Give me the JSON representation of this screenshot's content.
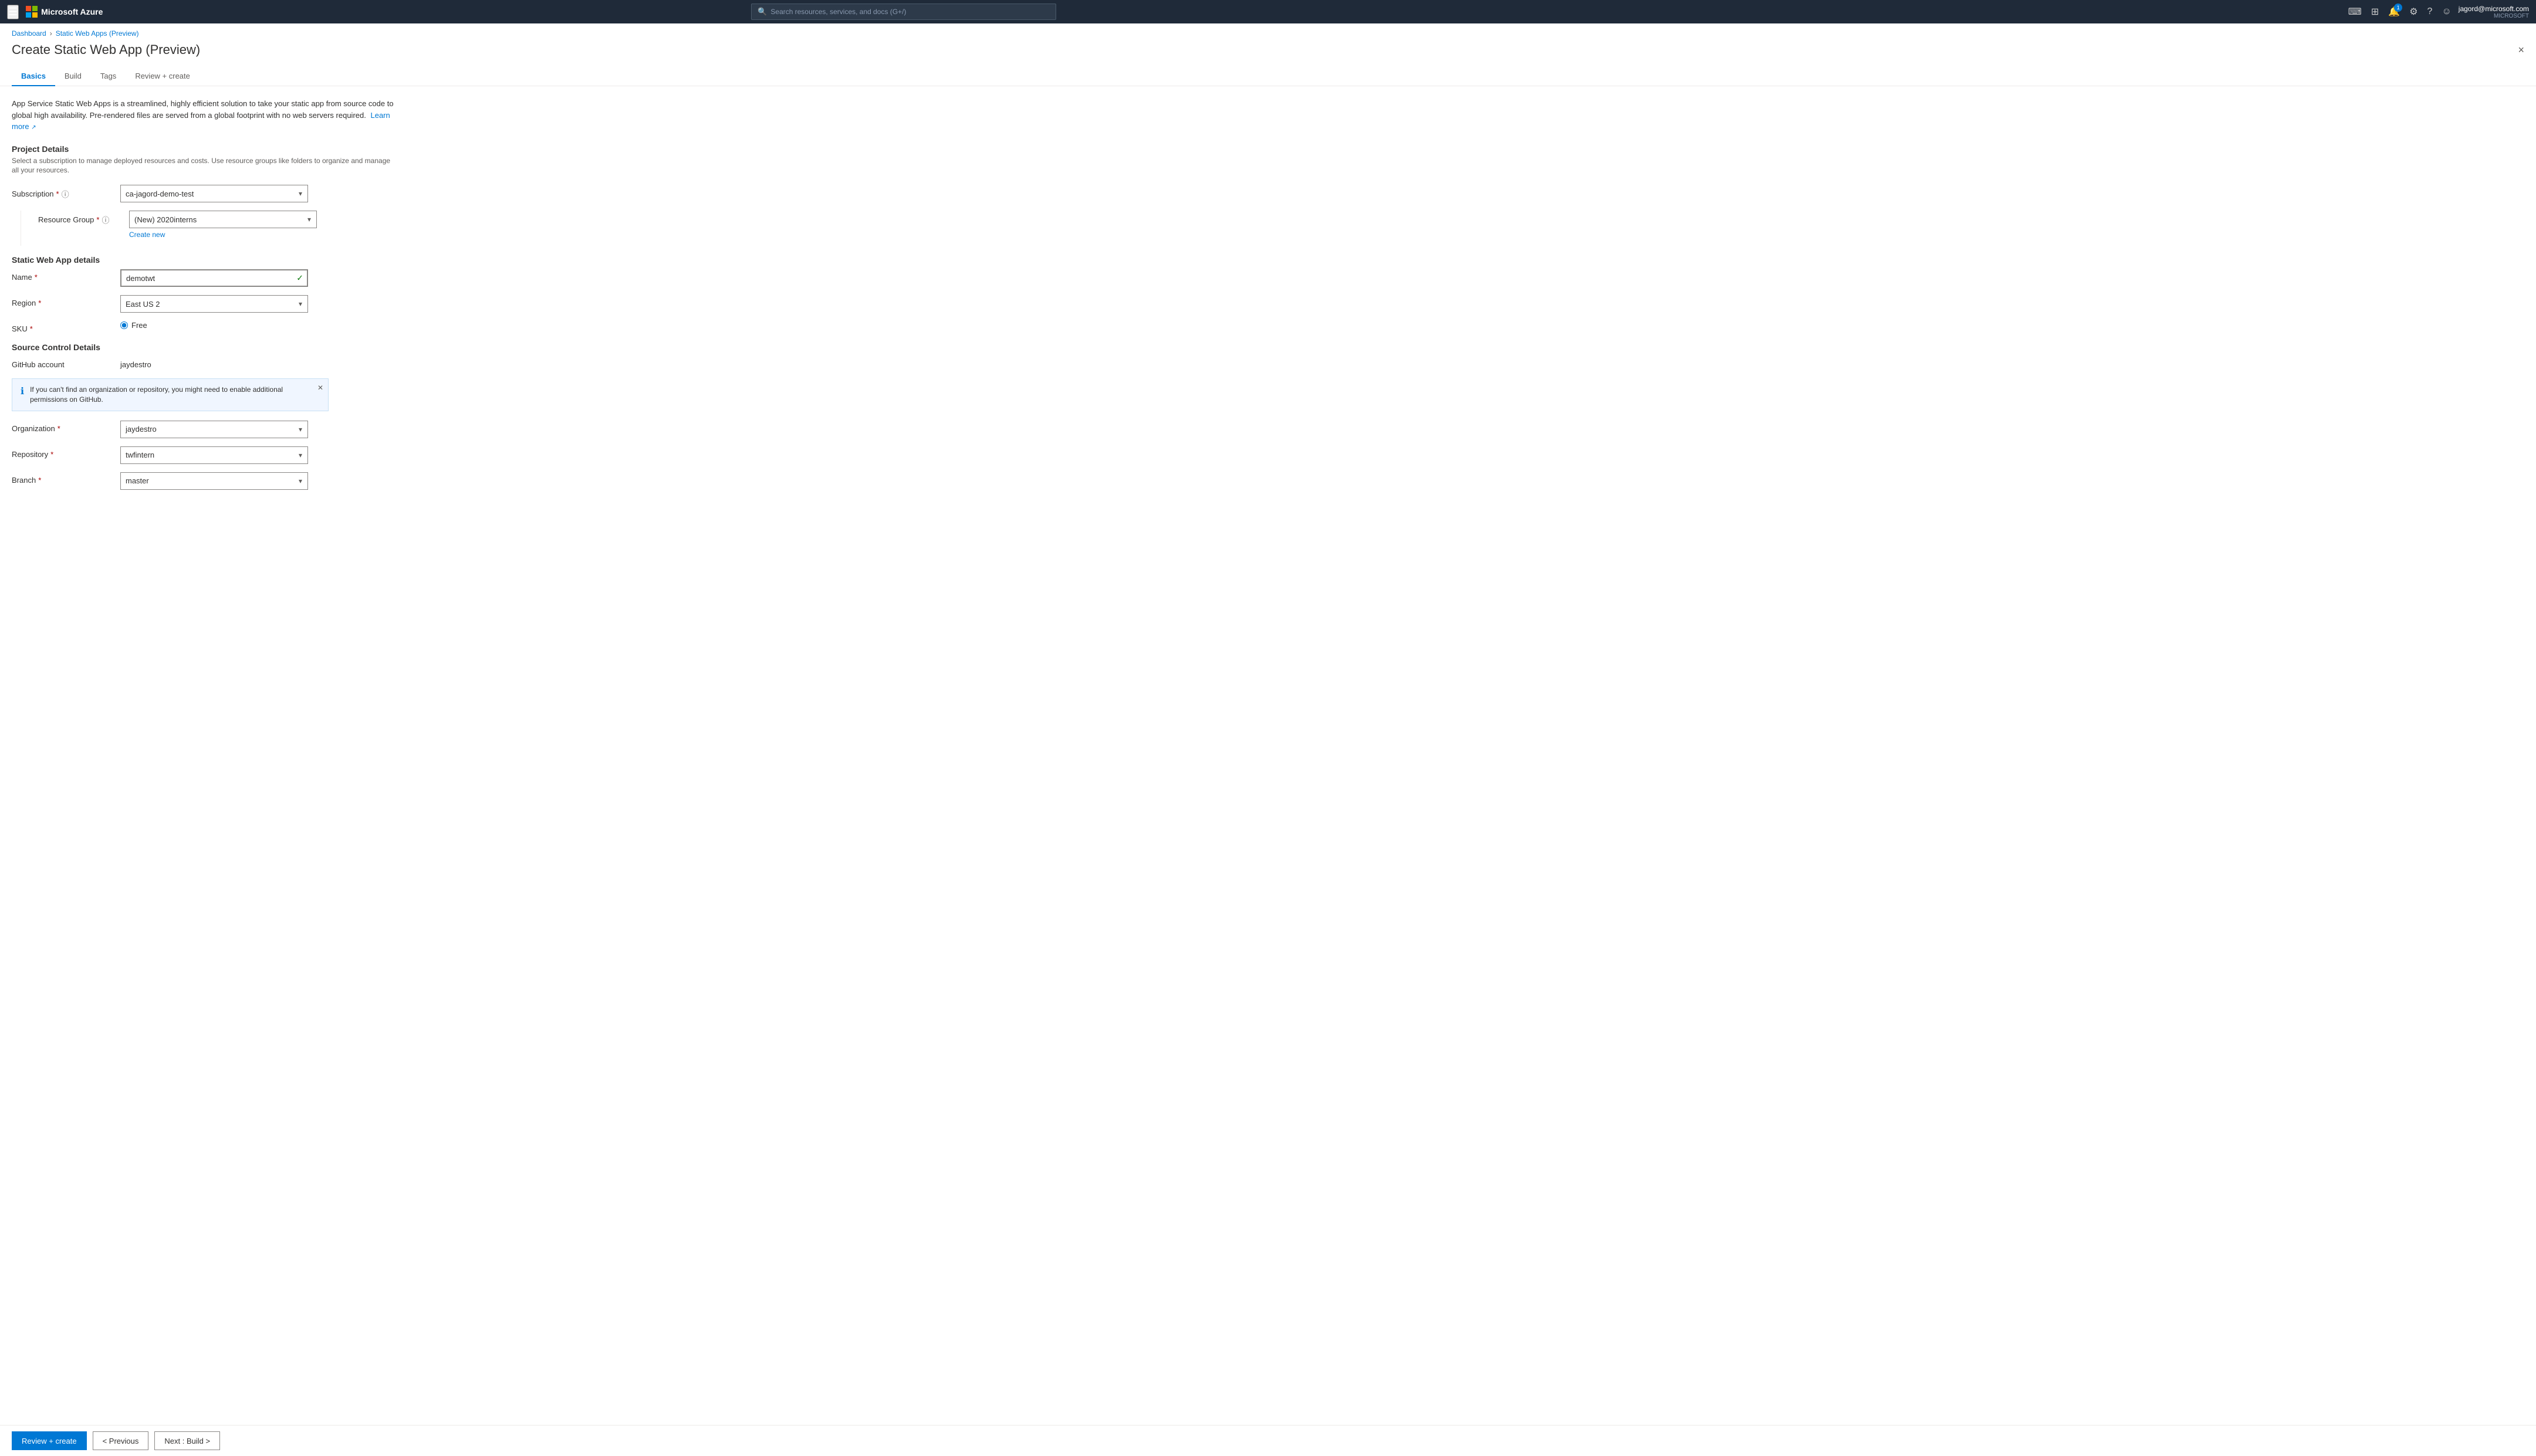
{
  "topnav": {
    "hamburger_icon": "☰",
    "brand": "Microsoft Azure",
    "search_placeholder": "Search resources, services, and docs (G+/)",
    "notification_count": "1",
    "user_name": "jagord@microsoft.com",
    "user_org": "MICROSOFT"
  },
  "breadcrumb": {
    "items": [
      {
        "label": "Dashboard",
        "href": "#"
      },
      {
        "label": "Static Web Apps (Preview)",
        "href": "#"
      }
    ],
    "separator": "›"
  },
  "page": {
    "title": "Create Static Web App (Preview)",
    "close_label": "×"
  },
  "tabs": [
    {
      "id": "basics",
      "label": "Basics",
      "active": true
    },
    {
      "id": "build",
      "label": "Build",
      "active": false
    },
    {
      "id": "tags",
      "label": "Tags",
      "active": false
    },
    {
      "id": "review",
      "label": "Review + create",
      "active": false
    }
  ],
  "description": {
    "text": "App Service Static Web Apps is a streamlined, highly efficient solution to take your static app from source code to global high availability. Pre-rendered files are served from a global footprint with no web servers required.",
    "learn_more": "Learn more",
    "learn_more_href": "#"
  },
  "project_details": {
    "title": "Project Details",
    "desc": "Select a subscription to manage deployed resources and costs. Use resource groups like folders to organize and manage all your resources.",
    "subscription": {
      "label": "Subscription",
      "required": true,
      "has_info": true,
      "value": "ca-jagord-demo-test"
    },
    "resource_group": {
      "label": "Resource Group",
      "required": true,
      "has_info": true,
      "value": "(New) 2020interns",
      "create_new": "Create new"
    }
  },
  "static_web_app_details": {
    "title": "Static Web App details",
    "name": {
      "label": "Name",
      "required": true,
      "value": "demotwt",
      "has_check": true
    },
    "region": {
      "label": "Region",
      "required": true,
      "value": "East US 2"
    },
    "sku": {
      "label": "SKU",
      "required": true,
      "options": [
        {
          "value": "free",
          "label": "Free",
          "selected": true
        }
      ]
    }
  },
  "source_control": {
    "title": "Source Control Details",
    "github_account": {
      "label": "GitHub account",
      "value": "jaydestro"
    },
    "info_banner": {
      "text": "If you can't find an organization or repository, you might need to enable additional permissions on GitHub."
    },
    "organization": {
      "label": "Organization",
      "required": true,
      "value": "jaydestro"
    },
    "repository": {
      "label": "Repository",
      "required": true,
      "value": "twfintern"
    },
    "branch": {
      "label": "Branch",
      "required": true,
      "value": "master"
    }
  },
  "bottom_bar": {
    "review_create": "Review + create",
    "previous": "< Previous",
    "next_build": "Next : Build >"
  }
}
